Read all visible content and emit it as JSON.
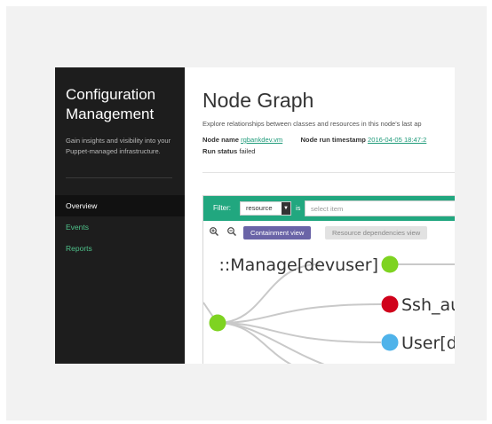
{
  "sidebar": {
    "title_line1": "Configuration",
    "title_line2": "Management",
    "description": "Gain insights and visibility into your Puppet-managed infrastructure.",
    "nav": [
      {
        "label": "Overview",
        "active": true
      },
      {
        "label": "Events",
        "active": false
      },
      {
        "label": "Reports",
        "active": false
      }
    ]
  },
  "main": {
    "title": "Node Graph",
    "subtitle": "Explore relationships between classes and resources in this node's last ap",
    "node_name_label": "Node name",
    "node_name_value": "rgbankdev.vm",
    "run_timestamp_label": "Node run timestamp",
    "run_timestamp_value": "2016-04-05 18:47:2",
    "run_status_label": "Run status",
    "run_status_value": "failed"
  },
  "filter": {
    "label": "Filter:",
    "select_value": "resource",
    "is_label": "is",
    "input_placeholder": "select item"
  },
  "toolbar": {
    "zoom_in_icon": "zoom-in-icon",
    "zoom_out_icon": "zoom-out-icon",
    "containment_view_label": "Containment view",
    "dependencies_view_label": "Resource dependencies view"
  },
  "graph": {
    "nodes": [
      {
        "label": "::Manage[devuser]",
        "color": "#7ed321"
      },
      {
        "label": "Ssh_au",
        "color": "#d0021b"
      },
      {
        "label": "User[d",
        "color": "#4fb3ea"
      }
    ],
    "root_color": "#7ed321",
    "edge_color": "#c9c9c9"
  },
  "colors": {
    "sidebar_bg": "#1d1d1d",
    "accent_green": "#21a77f",
    "link_green": "#4ec18a",
    "active_view": "#6a64a7"
  }
}
